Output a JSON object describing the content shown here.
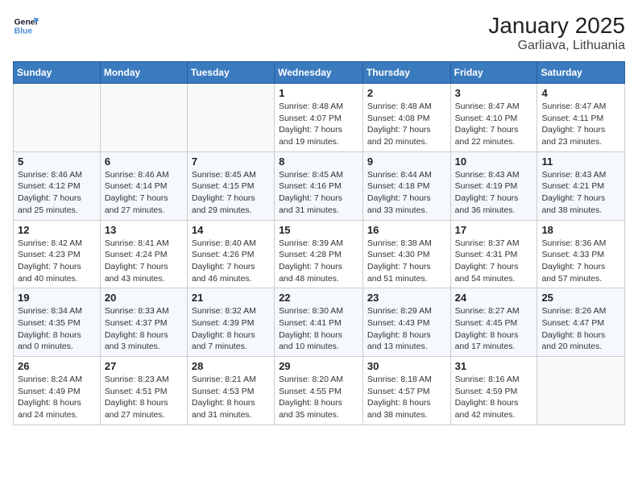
{
  "logo": {
    "line1": "General",
    "line2": "Blue"
  },
  "title": "January 2025",
  "subtitle": "Garliava, Lithuania",
  "weekdays": [
    "Sunday",
    "Monday",
    "Tuesday",
    "Wednesday",
    "Thursday",
    "Friday",
    "Saturday"
  ],
  "weeks": [
    [
      {
        "day": "",
        "info": ""
      },
      {
        "day": "",
        "info": ""
      },
      {
        "day": "",
        "info": ""
      },
      {
        "day": "1",
        "info": "Sunrise: 8:48 AM\nSunset: 4:07 PM\nDaylight: 7 hours\nand 19 minutes."
      },
      {
        "day": "2",
        "info": "Sunrise: 8:48 AM\nSunset: 4:08 PM\nDaylight: 7 hours\nand 20 minutes."
      },
      {
        "day": "3",
        "info": "Sunrise: 8:47 AM\nSunset: 4:10 PM\nDaylight: 7 hours\nand 22 minutes."
      },
      {
        "day": "4",
        "info": "Sunrise: 8:47 AM\nSunset: 4:11 PM\nDaylight: 7 hours\nand 23 minutes."
      }
    ],
    [
      {
        "day": "5",
        "info": "Sunrise: 8:46 AM\nSunset: 4:12 PM\nDaylight: 7 hours\nand 25 minutes."
      },
      {
        "day": "6",
        "info": "Sunrise: 8:46 AM\nSunset: 4:14 PM\nDaylight: 7 hours\nand 27 minutes."
      },
      {
        "day": "7",
        "info": "Sunrise: 8:45 AM\nSunset: 4:15 PM\nDaylight: 7 hours\nand 29 minutes."
      },
      {
        "day": "8",
        "info": "Sunrise: 8:45 AM\nSunset: 4:16 PM\nDaylight: 7 hours\nand 31 minutes."
      },
      {
        "day": "9",
        "info": "Sunrise: 8:44 AM\nSunset: 4:18 PM\nDaylight: 7 hours\nand 33 minutes."
      },
      {
        "day": "10",
        "info": "Sunrise: 8:43 AM\nSunset: 4:19 PM\nDaylight: 7 hours\nand 36 minutes."
      },
      {
        "day": "11",
        "info": "Sunrise: 8:43 AM\nSunset: 4:21 PM\nDaylight: 7 hours\nand 38 minutes."
      }
    ],
    [
      {
        "day": "12",
        "info": "Sunrise: 8:42 AM\nSunset: 4:23 PM\nDaylight: 7 hours\nand 40 minutes."
      },
      {
        "day": "13",
        "info": "Sunrise: 8:41 AM\nSunset: 4:24 PM\nDaylight: 7 hours\nand 43 minutes."
      },
      {
        "day": "14",
        "info": "Sunrise: 8:40 AM\nSunset: 4:26 PM\nDaylight: 7 hours\nand 46 minutes."
      },
      {
        "day": "15",
        "info": "Sunrise: 8:39 AM\nSunset: 4:28 PM\nDaylight: 7 hours\nand 48 minutes."
      },
      {
        "day": "16",
        "info": "Sunrise: 8:38 AM\nSunset: 4:30 PM\nDaylight: 7 hours\nand 51 minutes."
      },
      {
        "day": "17",
        "info": "Sunrise: 8:37 AM\nSunset: 4:31 PM\nDaylight: 7 hours\nand 54 minutes."
      },
      {
        "day": "18",
        "info": "Sunrise: 8:36 AM\nSunset: 4:33 PM\nDaylight: 7 hours\nand 57 minutes."
      }
    ],
    [
      {
        "day": "19",
        "info": "Sunrise: 8:34 AM\nSunset: 4:35 PM\nDaylight: 8 hours\nand 0 minutes."
      },
      {
        "day": "20",
        "info": "Sunrise: 8:33 AM\nSunset: 4:37 PM\nDaylight: 8 hours\nand 3 minutes."
      },
      {
        "day": "21",
        "info": "Sunrise: 8:32 AM\nSunset: 4:39 PM\nDaylight: 8 hours\nand 7 minutes."
      },
      {
        "day": "22",
        "info": "Sunrise: 8:30 AM\nSunset: 4:41 PM\nDaylight: 8 hours\nand 10 minutes."
      },
      {
        "day": "23",
        "info": "Sunrise: 8:29 AM\nSunset: 4:43 PM\nDaylight: 8 hours\nand 13 minutes."
      },
      {
        "day": "24",
        "info": "Sunrise: 8:27 AM\nSunset: 4:45 PM\nDaylight: 8 hours\nand 17 minutes."
      },
      {
        "day": "25",
        "info": "Sunrise: 8:26 AM\nSunset: 4:47 PM\nDaylight: 8 hours\nand 20 minutes."
      }
    ],
    [
      {
        "day": "26",
        "info": "Sunrise: 8:24 AM\nSunset: 4:49 PM\nDaylight: 8 hours\nand 24 minutes."
      },
      {
        "day": "27",
        "info": "Sunrise: 8:23 AM\nSunset: 4:51 PM\nDaylight: 8 hours\nand 27 minutes."
      },
      {
        "day": "28",
        "info": "Sunrise: 8:21 AM\nSunset: 4:53 PM\nDaylight: 8 hours\nand 31 minutes."
      },
      {
        "day": "29",
        "info": "Sunrise: 8:20 AM\nSunset: 4:55 PM\nDaylight: 8 hours\nand 35 minutes."
      },
      {
        "day": "30",
        "info": "Sunrise: 8:18 AM\nSunset: 4:57 PM\nDaylight: 8 hours\nand 38 minutes."
      },
      {
        "day": "31",
        "info": "Sunrise: 8:16 AM\nSunset: 4:59 PM\nDaylight: 8 hours\nand 42 minutes."
      },
      {
        "day": "",
        "info": ""
      }
    ]
  ]
}
